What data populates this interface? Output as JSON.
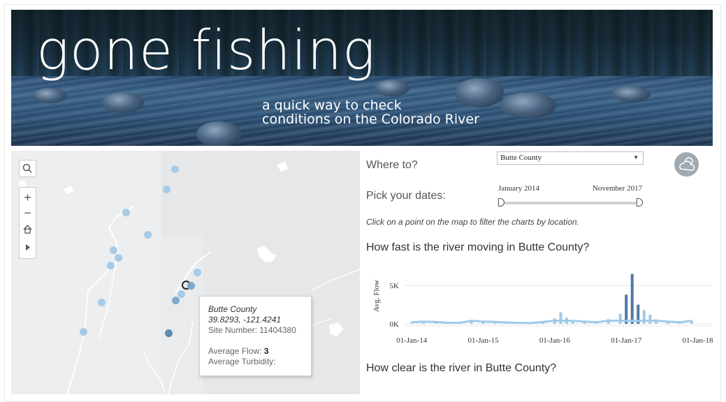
{
  "banner": {
    "title": "gone fishing",
    "subtitle_line1": "a quick way to check",
    "subtitle_line2": "conditions on the Colorado River"
  },
  "map": {
    "controls": [
      "search-icon",
      "zoom-in-icon",
      "zoom-out-icon",
      "home-icon",
      "play-icon"
    ],
    "tooltip": {
      "title": "Butte County",
      "coords": "39.8293, -121.4241",
      "site_label": "Site Number:",
      "site_value": "11404380",
      "flow_label": "Average Flow:",
      "flow_value": "3",
      "turbidity_label": "Average Turbidity:"
    }
  },
  "filters": {
    "where_label": "Where to?",
    "location_value": "Butte County",
    "dates_label": "Pick your dates:",
    "date_start": "January 2014",
    "date_end": "November 2017",
    "hint": "Click on a point on the map to filter the charts by location.",
    "weather_icon": "cloudy-sun-icon"
  },
  "charts": {
    "flow_title": "How fast is the river moving in Butte County?",
    "clarity_title": "How clear is the river in Butte County?"
  },
  "chart_data": {
    "type": "area",
    "ylabel": "Avg. Flow",
    "y_ticks": [
      "5K",
      "0K"
    ],
    "x_ticks": [
      "01-Jan-14",
      "01-Jan-15",
      "01-Jan-16",
      "01-Jan-17",
      "01-Jan-18"
    ],
    "ylim": [
      0,
      8000
    ],
    "color_light": "#9ecae9",
    "color_dark": "#4e79a7",
    "x": [
      "2014-01",
      "2014-03",
      "2014-05",
      "2014-07",
      "2014-09",
      "2014-11",
      "2015-01",
      "2015-03",
      "2015-05",
      "2015-07",
      "2015-09",
      "2015-11",
      "2016-01",
      "2016-02",
      "2016-03",
      "2016-04",
      "2016-06",
      "2016-08",
      "2016-10",
      "2016-12",
      "2017-01",
      "2017-02",
      "2017-03",
      "2017-04",
      "2017-05",
      "2017-06",
      "2017-08",
      "2017-10",
      "2017-12"
    ],
    "values": [
      200,
      300,
      250,
      150,
      120,
      400,
      300,
      250,
      180,
      120,
      100,
      250,
      700,
      1500,
      800,
      500,
      300,
      200,
      600,
      1300,
      3800,
      6500,
      2500,
      1800,
      1200,
      600,
      300,
      200,
      400
    ]
  }
}
